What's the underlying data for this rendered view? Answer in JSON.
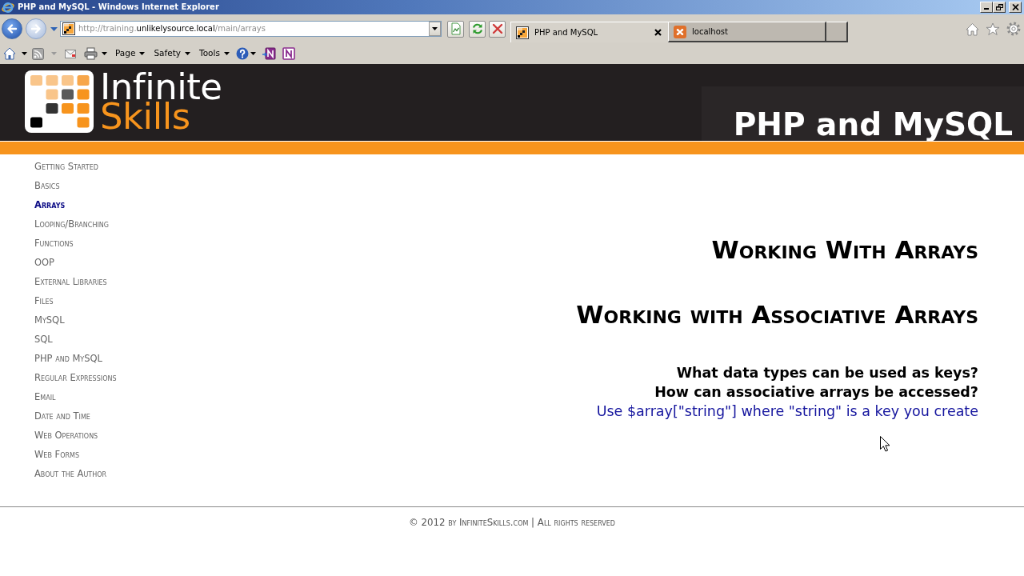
{
  "window": {
    "title": "PHP and MySQL - Windows Internet Explorer"
  },
  "nav_buttons": [
    {
      "kind": "back",
      "disabled": false
    },
    {
      "kind": "forward",
      "disabled": true
    }
  ],
  "address_bar": {
    "url": {
      "prefix": "http://training.",
      "host": "unlikelysource.local",
      "path": "/main/arrays"
    }
  },
  "tabs": [
    {
      "label": "PHP and MySQL",
      "selected": true
    },
    {
      "label": "localhost",
      "selected": false
    }
  ],
  "command_bar": {
    "menus": [
      "Page",
      "Safety",
      "Tools"
    ]
  },
  "header": {
    "logo": {
      "line_1": "Infinite",
      "line_2": "Skills"
    },
    "title": "PHP and MySQL"
  },
  "sidebar": {
    "items": [
      {
        "label": "Getting Started",
        "selected": false
      },
      {
        "label": "Basics",
        "selected": false
      },
      {
        "label": "Arrays",
        "selected": true
      },
      {
        "label": "Looping/Branching",
        "selected": false
      },
      {
        "label": "Functions",
        "selected": false
      },
      {
        "label": "OOP",
        "selected": false
      },
      {
        "label": "External Libraries",
        "selected": false
      },
      {
        "label": "Files",
        "selected": false
      },
      {
        "label": "MySQL",
        "selected": false
      },
      {
        "label": "SQL",
        "selected": false
      },
      {
        "label": "PHP and MySQL",
        "selected": false
      },
      {
        "label": "Regular Expressions",
        "selected": false
      },
      {
        "label": "Email",
        "selected": false
      },
      {
        "label": "Date and Time",
        "selected": false
      },
      {
        "label": "Web Operations",
        "selected": false
      },
      {
        "label": "Web Forms",
        "selected": false
      },
      {
        "label": "About the Author",
        "selected": false
      }
    ]
  },
  "content": {
    "heading": "Working With Arrays",
    "subheading": "Working with Associative Arrays",
    "lines": [
      {
        "kind": "question",
        "text": "What data types can be used as keys?"
      },
      {
        "kind": "question",
        "text": "How can associative arrays be accessed?"
      },
      {
        "kind": "answer",
        "text": "Use $array[\"string\"] where \"string\" is a key you create"
      }
    ]
  },
  "footer": {
    "text": "© 2012 by InfiniteSkills.com | All rights reserved"
  }
}
